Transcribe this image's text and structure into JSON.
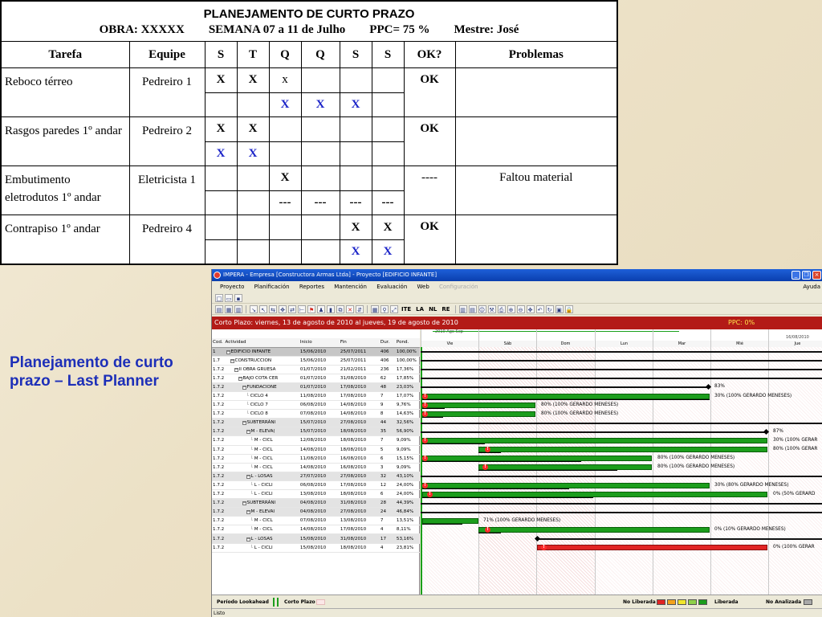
{
  "plan": {
    "title": "PLANEJAMENTO DE CURTO PRAZO",
    "subtitle": "OBRA: XXXXX        SEMANA 07 a 11 de Julho        PPC= 75 %        Mestre: José",
    "headers": [
      "Tarefa",
      "Equipe",
      "S",
      "T",
      "Q",
      "Q",
      "S",
      "S",
      "OK?",
      "Problemas"
    ],
    "rows": [
      {
        "task": "Reboco térreo",
        "team": "Pedreiro 1",
        "planned": [
          "X",
          "X",
          "x",
          "",
          "",
          ""
        ],
        "done": [
          "",
          "",
          "X",
          "X",
          "X",
          ""
        ],
        "ok": "OK",
        "problem": ""
      },
      {
        "task": "Rasgos paredes 1º andar",
        "team": "Pedreiro 2",
        "planned": [
          "X",
          "X",
          "",
          "",
          "",
          ""
        ],
        "done": [
          "X",
          "X",
          "",
          "",
          "",
          ""
        ],
        "ok": "OK",
        "problem": ""
      },
      {
        "task": "Embutimento eletrodutos 1º andar",
        "team": "Eletricista 1",
        "planned": [
          "",
          "",
          "X",
          "",
          "",
          ""
        ],
        "done": [
          "",
          "",
          "---",
          "---",
          "---",
          "---"
        ],
        "ok": "----",
        "problem": "Faltou material"
      },
      {
        "task": "Contrapiso 1º andar",
        "team": "Pedreiro 4",
        "planned": [
          "",
          "",
          "",
          "",
          "X",
          "X"
        ],
        "done": [
          "",
          "",
          "",
          "",
          "X",
          "X"
        ],
        "ok": "OK",
        "problem": ""
      }
    ]
  },
  "caption": "Planejamento de curto prazo – Last Planner",
  "app": {
    "window_title": "IMPERA - Empresa [Constructora Armas Ltda] - Proyecto [EDIFICIO INFANTE]",
    "menu": [
      "Proyecto",
      "Planificación",
      "Reportes",
      "Mantención",
      "Evaluación",
      "Web"
    ],
    "menu_disabled": "Configuración",
    "menu_help": "Ayuda",
    "toolbar_text": [
      "ITE",
      "LA",
      "NL",
      "RE"
    ],
    "period": "Corto Plazo: viernes, 13 de agosto de 2010   al   jueves, 19 de agosto de 2010",
    "ppc": "PPC: 0%",
    "grid_headers": [
      "Cod.",
      "Actividad",
      "Inicio",
      "Fin",
      "Dur.",
      "Pond."
    ],
    "rows": [
      {
        "cod": "1",
        "act": "EDIFICIO INFANTE",
        "start": "15/06/2010",
        "end": "25/07/2011",
        "dur": "406",
        "pond": "100,00%",
        "style": "sel",
        "lvl": 0
      },
      {
        "cod": "1.7",
        "act": "CONSTRUCCION",
        "start": "15/06/2010",
        "end": "25/07/2011",
        "dur": "406",
        "pond": "100,00%",
        "style": "",
        "lvl": 1
      },
      {
        "cod": "1.7.2",
        "act": "II OBRA GRUESA",
        "start": "01/07/2010",
        "end": "21/02/2011",
        "dur": "236",
        "pond": "17,36%",
        "style": "",
        "lvl": 2
      },
      {
        "cod": "1.7.2",
        "act": "BAJO COTA CER",
        "start": "01/07/2010",
        "end": "31/08/2010",
        "dur": "62",
        "pond": "17,85%",
        "style": "",
        "lvl": 3
      },
      {
        "cod": "1.7.2",
        "act": "FUNDACIONE",
        "start": "01/07/2010",
        "end": "17/08/2010",
        "dur": "48",
        "pond": "23,03%",
        "style": "grp",
        "lvl": 4
      },
      {
        "cod": "1.7.2",
        "act": "CICLO 4",
        "start": "11/08/2010",
        "end": "17/08/2010",
        "dur": "7",
        "pond": "17,07%",
        "style": "",
        "lvl": 5
      },
      {
        "cod": "1.7.2",
        "act": "CICLO 7",
        "start": "06/08/2010",
        "end": "14/08/2010",
        "dur": "9",
        "pond": "9,76%",
        "style": "",
        "lvl": 5
      },
      {
        "cod": "1.7.2",
        "act": "CICLO 8",
        "start": "07/08/2010",
        "end": "14/08/2010",
        "dur": "8",
        "pond": "14,63%",
        "style": "",
        "lvl": 5
      },
      {
        "cod": "1.7.2",
        "act": "SUBTERRÁNI",
        "start": "15/07/2010",
        "end": "27/08/2010",
        "dur": "44",
        "pond": "32,56%",
        "style": "grp",
        "lvl": 4
      },
      {
        "cod": "1.7.2",
        "act": "M - ELEVA(",
        "start": "15/07/2010",
        "end": "18/08/2010",
        "dur": "35",
        "pond": "56,90%",
        "style": "grp",
        "lvl": 5
      },
      {
        "cod": "1.7.2",
        "act": "M - CICL",
        "start": "12/08/2010",
        "end": "18/08/2010",
        "dur": "7",
        "pond": "9,09%",
        "style": "",
        "lvl": 6
      },
      {
        "cod": "1.7.2",
        "act": "M - CICL",
        "start": "14/08/2010",
        "end": "18/08/2010",
        "dur": "5",
        "pond": "9,09%",
        "style": "",
        "lvl": 6
      },
      {
        "cod": "1.7.2",
        "act": "M - CICL",
        "start": "11/08/2010",
        "end": "16/08/2010",
        "dur": "6",
        "pond": "15,15%",
        "style": "",
        "lvl": 6
      },
      {
        "cod": "1.7.2",
        "act": "M - CICL",
        "start": "14/08/2010",
        "end": "16/08/2010",
        "dur": "3",
        "pond": "9,09%",
        "style": "",
        "lvl": 6
      },
      {
        "cod": "1.7.2",
        "act": "L - LOSAS",
        "start": "27/07/2010",
        "end": "27/08/2010",
        "dur": "32",
        "pond": "43,10%",
        "style": "grp",
        "lvl": 5
      },
      {
        "cod": "1.7.2",
        "act": "L - CICLI",
        "start": "06/08/2010",
        "end": "17/08/2010",
        "dur": "12",
        "pond": "24,00%",
        "style": "",
        "lvl": 6
      },
      {
        "cod": "1.7.2",
        "act": "L - CICLI",
        "start": "13/08/2010",
        "end": "18/08/2010",
        "dur": "6",
        "pond": "24,00%",
        "style": "",
        "lvl": 6
      },
      {
        "cod": "1.7.2",
        "act": "SUBTERRÁNI",
        "start": "04/08/2010",
        "end": "31/08/2010",
        "dur": "28",
        "pond": "44,39%",
        "style": "grp",
        "lvl": 4
      },
      {
        "cod": "1.7.2",
        "act": "M - ELEVAI",
        "start": "04/08/2010",
        "end": "27/08/2010",
        "dur": "24",
        "pond": "46,84%",
        "style": "grp",
        "lvl": 5
      },
      {
        "cod": "1.7.2",
        "act": "M - CICL",
        "start": "07/08/2010",
        "end": "13/08/2010",
        "dur": "7",
        "pond": "13,51%",
        "style": "",
        "lvl": 6
      },
      {
        "cod": "1.7.2",
        "act": "M - CICL",
        "start": "14/08/2010",
        "end": "17/08/2010",
        "dur": "4",
        "pond": "8,11%",
        "style": "",
        "lvl": 6
      },
      {
        "cod": "1.7.2",
        "act": "L - LOSAS",
        "start": "15/08/2010",
        "end": "31/08/2010",
        "dur": "17",
        "pond": "53,16%",
        "style": "grp",
        "lvl": 5
      },
      {
        "cod": "1.7.2",
        "act": "L - CICLI",
        "start": "15/08/2010",
        "end": "18/08/2010",
        "dur": "4",
        "pond": "23,81%",
        "style": "",
        "lvl": 6
      }
    ],
    "gantt": {
      "top_left": "2010 Ago Sep",
      "top_right": "16/08/2010",
      "days": [
        "Vie",
        "Sáb",
        "Dom",
        "Lun",
        "Mar",
        "Mié",
        "Jue"
      ],
      "labels": {
        "r4": "83%",
        "r5": "30% (100% GERARDO MENESES)",
        "r6": "80% (100% GERARDO MENESES)",
        "r7": "80% (100% GERARDO MENESES)",
        "r9": "87%",
        "r10": "30% (100% GERAR",
        "r11": "80% (100% GERAR",
        "r12": "80% (100% GERARDO MENESES)",
        "r13": "80% (100% GERARDO MENESES)",
        "r15": "30% (80% GERARDO MENESES)",
        "r16": "0% (50% GERARD",
        "r19": "71% (100% GERARDO MENESES)",
        "r20": "0% (10% GERARDO MENESES)",
        "r22": "0% (100% GERAR"
      }
    },
    "legend": {
      "tab1": "Período Lookahead",
      "tab2": "Corto Plazo",
      "no_lib": "No Liberada",
      "lib": "Liberada",
      "no_an": "No Analizada",
      "colors": [
        "#e12424",
        "#f3a21c",
        "#f0e52c",
        "#8ed04a",
        "#1c9d1c"
      ]
    },
    "status": "Listo"
  }
}
